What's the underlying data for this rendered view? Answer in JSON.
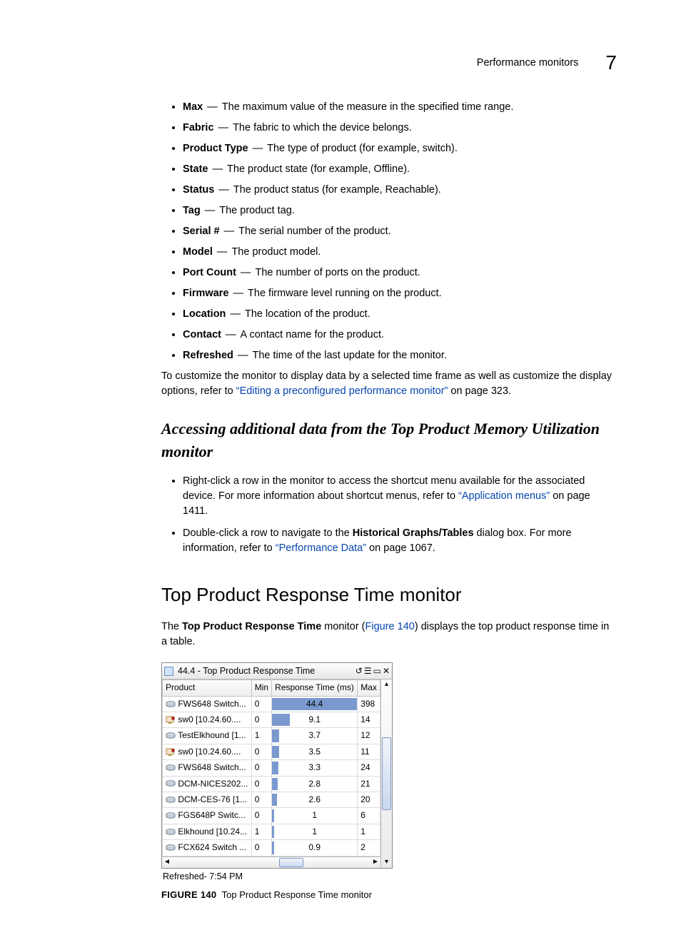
{
  "header": {
    "title": "Performance monitors",
    "chapter_number": "7"
  },
  "definitions": [
    {
      "term": "Max",
      "desc": "The maximum value of the measure in the specified time range."
    },
    {
      "term": "Fabric",
      "desc": "The fabric to which the device belongs."
    },
    {
      "term": "Product Type",
      "desc": "The type of product (for example, switch)."
    },
    {
      "term": "State",
      "desc": "The product state (for example, Offline)."
    },
    {
      "term": "Status",
      "desc": "The product status (for example, Reachable)."
    },
    {
      "term": "Tag",
      "desc": "The product tag."
    },
    {
      "term": "Serial #",
      "desc": "The serial number of the product."
    },
    {
      "term": "Model",
      "desc": "The product model."
    },
    {
      "term": "Port Count",
      "desc": "The number of ports on the product."
    },
    {
      "term": "Firmware",
      "desc": "The firmware level running on the product."
    },
    {
      "term": "Location",
      "desc": "The location of the product."
    },
    {
      "term": "Contact",
      "desc": "A contact name for the product."
    },
    {
      "term": "Refreshed",
      "desc": "The time of the last update for the monitor."
    }
  ],
  "customize_para": {
    "before": "To customize the monitor to display data by a selected time frame as well as customize the display options, refer to ",
    "link": "“Editing a preconfigured performance monitor”",
    "after": " on page 323."
  },
  "subheading_accessing": "Accessing additional data from the Top Product Memory Utilization monitor",
  "accessing_bullets": {
    "b1_before": "Right-click a row in the monitor to access the shortcut menu available for the associated device. For more information about shortcut menus, refer to ",
    "b1_link": "“Application menus”",
    "b1_after": " on page 1411.",
    "b2_before": "Double-click a row to navigate to the ",
    "b2_strong": "Historical Graphs/Tables",
    "b2_mid": " dialog box. For more information, refer to ",
    "b2_link": "“Performance Data”",
    "b2_after": " on page 1067."
  },
  "section_title": "Top Product Response Time monitor",
  "section_para": {
    "before": "The ",
    "strong": "Top Product Response Time",
    "mid": " monitor (",
    "link": "Figure 140",
    "after": ") displays the top product response time in a table."
  },
  "monitor": {
    "title": "44.4 - Top Product Response Time",
    "columns": {
      "c1": "Product",
      "c2": "Min",
      "c3": "Response Time (ms)",
      "c4": "Max"
    },
    "refreshed": "Refreshed- 7:54 PM"
  },
  "figure_caption": {
    "num": "FIGURE 140",
    "text": "Top Product Response Time monitor"
  },
  "chart_data": {
    "type": "bar",
    "title": "44.4 - Top Product Response Time",
    "xlabel": "Response Time (ms)",
    "ylabel": "Product",
    "series": [
      {
        "product": "FWS648 Switch...",
        "icon": "disk",
        "min": 0,
        "value": 44.4,
        "max": 398
      },
      {
        "product": "sw0 [10.24.60....",
        "icon": "host",
        "min": 0,
        "value": 9.1,
        "max": 14
      },
      {
        "product": "TestElkhound [1...",
        "icon": "disk",
        "min": 1,
        "value": 3.7,
        "max": 12
      },
      {
        "product": "sw0 [10.24.60....",
        "icon": "host",
        "min": 0,
        "value": 3.5,
        "max": 11
      },
      {
        "product": "FWS648 Switch...",
        "icon": "disk",
        "min": 0,
        "value": 3.3,
        "max": 24
      },
      {
        "product": "DCM-NICES202...",
        "icon": "disk",
        "min": 0,
        "value": 2.8,
        "max": 21
      },
      {
        "product": "DCM-CES-76 [1...",
        "icon": "disk",
        "min": 0,
        "value": 2.6,
        "max": 20
      },
      {
        "product": "FGS648P Switc...",
        "icon": "disk",
        "min": 0,
        "value": 1,
        "max": 6
      },
      {
        "product": "Elkhound [10.24...",
        "icon": "disk",
        "min": 1,
        "value": 1,
        "max": 1
      },
      {
        "product": "FCX624 Switch ...",
        "icon": "disk",
        "min": 0,
        "value": 0.9,
        "max": 2
      }
    ],
    "xlim": [
      0,
      44.4
    ]
  }
}
